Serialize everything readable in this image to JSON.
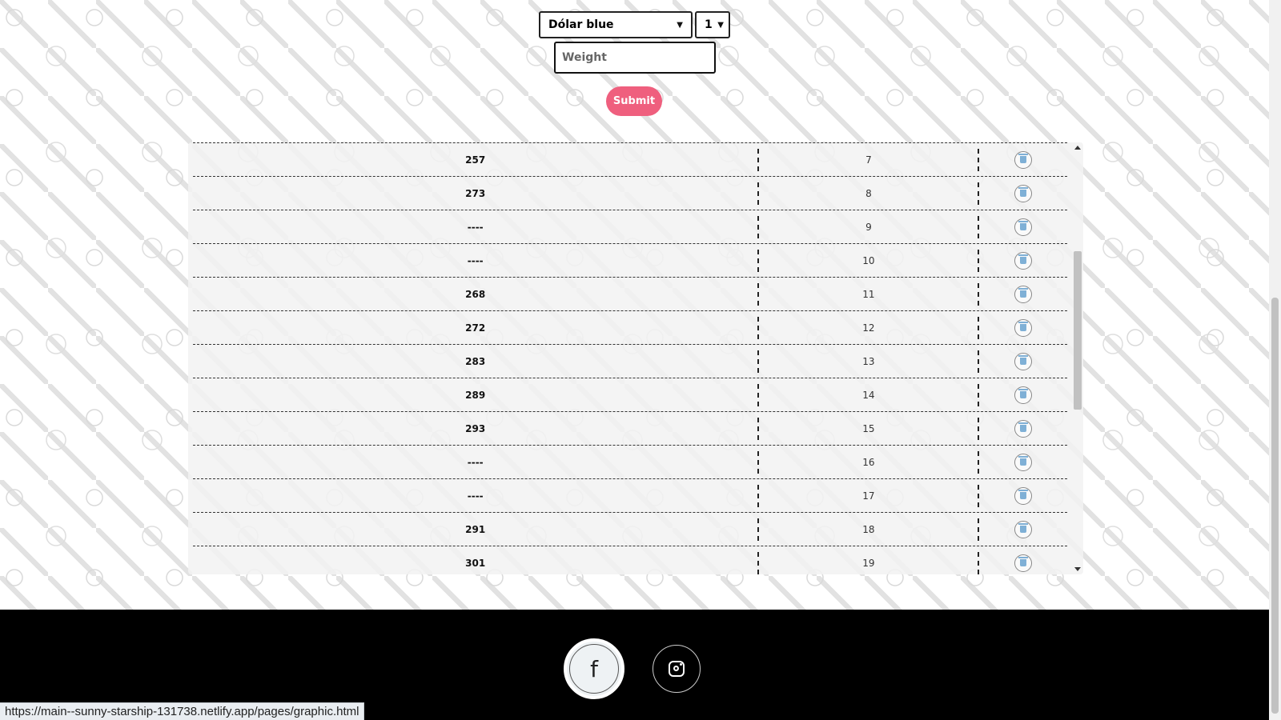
{
  "form": {
    "currency_select": "Dólar blue",
    "qty_select": "1",
    "weight_placeholder": "Weight",
    "submit_label": "Submit"
  },
  "table": {
    "rows": [
      {
        "weight": "257",
        "number": "7"
      },
      {
        "weight": "273",
        "number": "8"
      },
      {
        "weight": "----",
        "number": "9"
      },
      {
        "weight": "----",
        "number": "10"
      },
      {
        "weight": "268",
        "number": "11"
      },
      {
        "weight": "272",
        "number": "12"
      },
      {
        "weight": "283",
        "number": "13"
      },
      {
        "weight": "289",
        "number": "14"
      },
      {
        "weight": "293",
        "number": "15"
      },
      {
        "weight": "----",
        "number": "16"
      },
      {
        "weight": "----",
        "number": "17"
      },
      {
        "weight": "291",
        "number": "18"
      },
      {
        "weight": "301",
        "number": "19"
      }
    ],
    "delete_icon": "trash-icon"
  },
  "footer": {
    "social": [
      "facebook-icon",
      "instagram-icon"
    ]
  },
  "status_bar": {
    "url": "https://main--sunny-starship-131738.netlify.app/pages/graphic.html"
  },
  "colors": {
    "submit": "#ef5f7e",
    "footer": "#000000",
    "trash": "#7fb0d6"
  }
}
